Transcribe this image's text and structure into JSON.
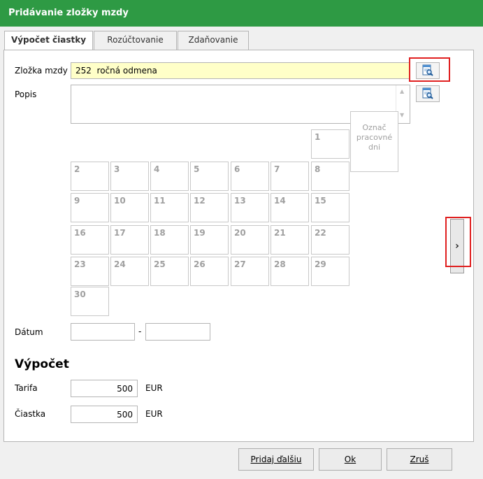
{
  "window": {
    "title": "Pridávanie zložky mzdy"
  },
  "tabs": [
    {
      "label": "Výpočet čiastky",
      "active": true
    },
    {
      "label": "Rozúčtovanie",
      "active": false
    },
    {
      "label": "Zdaňovanie",
      "active": false
    }
  ],
  "form": {
    "component": {
      "label": "Zložka mzdy",
      "value": "252  ročná odmena",
      "lookup_icon": "lookup-icon"
    },
    "description": {
      "label": "Popis",
      "value": "",
      "lookup_icon": "lookup-icon"
    },
    "calendar": {
      "days": [
        "1",
        "2",
        "3",
        "4",
        "5",
        "6",
        "7",
        "8",
        "9",
        "10",
        "11",
        "12",
        "13",
        "14",
        "15",
        "16",
        "17",
        "18",
        "19",
        "20",
        "21",
        "22",
        "23",
        "24",
        "25",
        "26",
        "27",
        "28",
        "29",
        "30"
      ],
      "mark_working_days": "Označ pracovné dni"
    },
    "date": {
      "label": "Dátum",
      "from": "",
      "to": "",
      "separator": "-"
    },
    "calculation": {
      "title": "Výpočet",
      "tariff": {
        "label": "Tarifa",
        "value": "500",
        "unit": "EUR"
      },
      "amount": {
        "label": "Čiastka",
        "value": "500",
        "unit": "EUR"
      }
    }
  },
  "side_panel_toggle": {
    "icon": "chevron-right-icon",
    "glyph": "›"
  },
  "buttons": {
    "add_next": "Pridaj ďalšiu",
    "ok": "Ok",
    "cancel": "Zruš"
  }
}
